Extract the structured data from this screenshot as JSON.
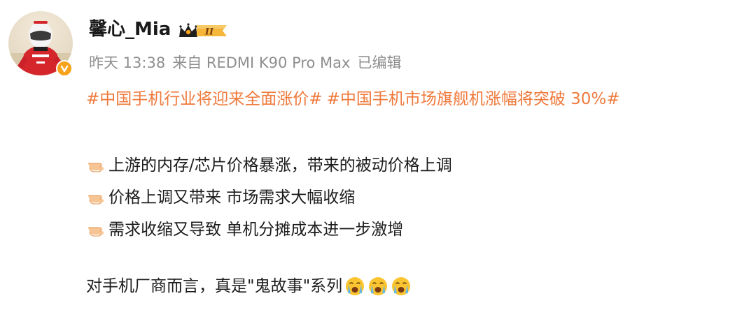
{
  "author": {
    "name": "馨心_Mia",
    "level_badge": "II",
    "verified_icon": "verified-badge-icon",
    "accent_color": "#f7a21b"
  },
  "meta": {
    "time": "昨天 13:38",
    "source": "来自 REDMI K90 Pro Max",
    "edited": "已编辑"
  },
  "hashtags": [
    "#中国手机行业将迎来全面涨价#",
    "#中国手机市场旗舰机涨幅将突破 30%#"
  ],
  "hashtag_color": "#ef7a3c",
  "bullets": [
    {
      "icon": "pointing-hand-icon",
      "text": "上游的内存/芯片价格暴涨，带来的被动价格上调"
    },
    {
      "icon": "pointing-hand-icon",
      "text": "价格上调又带来 市场需求大幅收缩"
    },
    {
      "icon": "pointing-hand-icon",
      "text": "需求收缩又导致 单机分摊成本进一步激增"
    }
  ],
  "closing": {
    "text": "对手机厂商而言，真是\"鬼故事\"系列",
    "emojis": [
      "crying-face-icon",
      "crying-face-icon",
      "crying-face-icon"
    ]
  }
}
